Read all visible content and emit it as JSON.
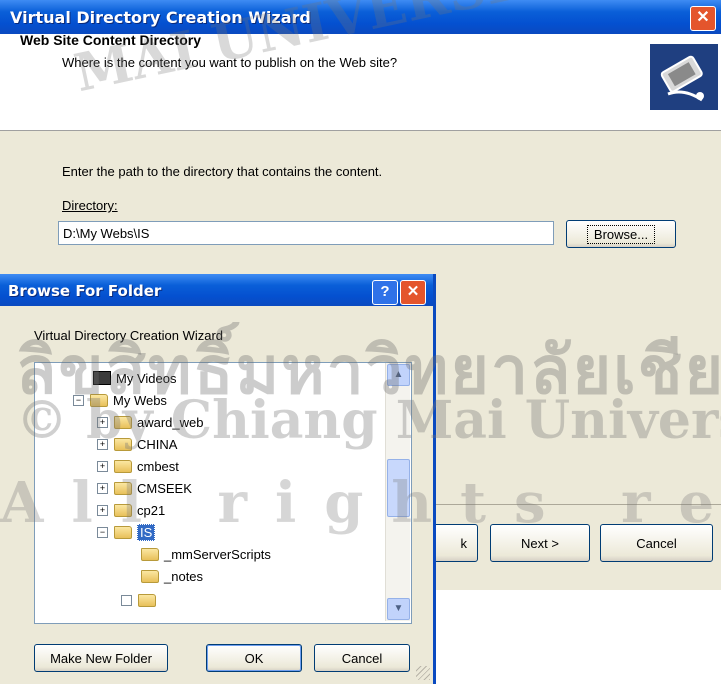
{
  "wizard": {
    "title": "Virtual Directory Creation Wizard",
    "close_glyph": "✕",
    "header_title": "Web Site Content Directory",
    "header_subtitle": "Where is the content you want to publish on the Web site?",
    "instruction": "Enter the path to the directory that contains the content.",
    "directory_label": "Directory:",
    "directory_value": "D:\\My Webs\\IS",
    "browse_label": "Browse...",
    "back_label": "k",
    "next_label": "Next >",
    "cancel_label": "Cancel"
  },
  "browse_dialog": {
    "title": "Browse For Folder",
    "help_glyph": "?",
    "close_glyph": "✕",
    "description": "Virtual Directory Creation Wizard",
    "tree": [
      {
        "label": "My Videos",
        "icon": "video-folder-icon",
        "expander": ""
      },
      {
        "label": "My Webs",
        "icon": "folder-icon",
        "expander": "−"
      },
      {
        "label": "award_web",
        "icon": "folder-icon",
        "expander": "+"
      },
      {
        "label": "CHINA",
        "icon": "folder-icon",
        "expander": "+"
      },
      {
        "label": "cmbest",
        "icon": "folder-icon",
        "expander": "+"
      },
      {
        "label": "CMSEEK",
        "icon": "folder-icon",
        "expander": "+"
      },
      {
        "label": "cp21",
        "icon": "folder-icon",
        "expander": "+"
      },
      {
        "label": "IS",
        "icon": "open-folder-icon",
        "expander": "−",
        "selected": true
      },
      {
        "label": "_mmServerScripts",
        "icon": "folder-icon",
        "expander": ""
      },
      {
        "label": "_notes",
        "icon": "folder-icon",
        "expander": ""
      }
    ],
    "make_new_folder_label": "Make New Folder",
    "ok_label": "OK",
    "cancel_label": "Cancel"
  },
  "watermark": {
    "arc_text": "MAI UNIVERSITY",
    "thai_text": "ลิขสิทธิ์มหาวิทยาลัยเชียงใหม่",
    "copyright_text": "© by Chiang Mai University",
    "rights_text": "All rights reserved"
  },
  "colors": {
    "titlebar_blue": "#0a5fd8",
    "dialog_face": "#ece9d8",
    "selection": "#316ac5",
    "close_red": "#e4552c"
  }
}
